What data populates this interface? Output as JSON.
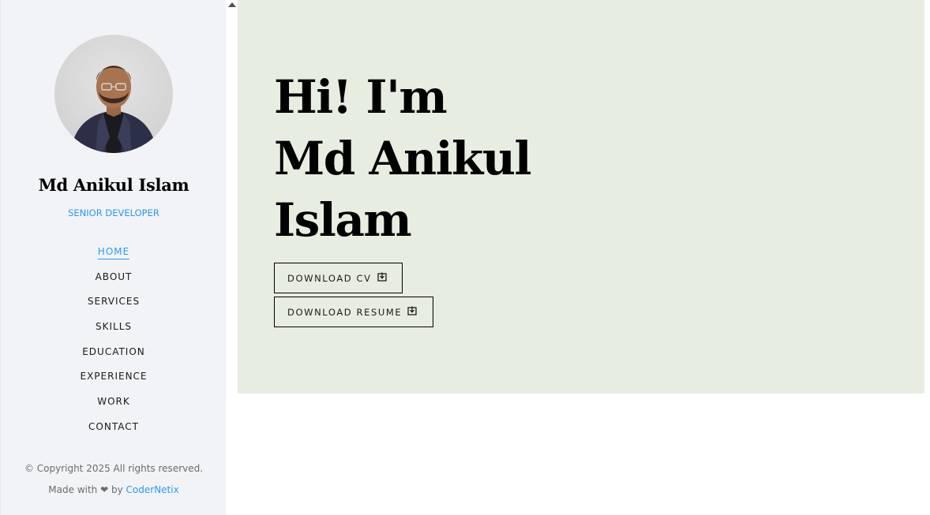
{
  "profile": {
    "name": "Md Anikul Islam",
    "role": "SENIOR DEVELOPER"
  },
  "nav": {
    "items": [
      {
        "label": "HOME",
        "active": true
      },
      {
        "label": "ABOUT",
        "active": false
      },
      {
        "label": "SERVICES",
        "active": false
      },
      {
        "label": "SKILLS",
        "active": false
      },
      {
        "label": "EDUCATION",
        "active": false
      },
      {
        "label": "EXPERIENCE",
        "active": false
      },
      {
        "label": "WORK",
        "active": false
      },
      {
        "label": "CONTACT",
        "active": false
      }
    ]
  },
  "footer": {
    "copyright": "© Copyright 2025 All rights reserved.",
    "made_with": "Made with",
    "heart": "❤",
    "by": "by",
    "credit_link": "CoderNetix"
  },
  "hero": {
    "line1": "Hi! I'm",
    "line2": "Md Anikul",
    "line3": "Islam",
    "download_cv_label": "DOWNLOAD CV",
    "download_resume_label": "DOWNLOAD RESUME"
  },
  "icons": {
    "avatar": "profile-photo",
    "download": "download-icon",
    "scroll_up": "chevron-up-icon"
  },
  "colors": {
    "accent": "#2c98f0",
    "sidebar_bg": "#f2f3f7",
    "hero_bg": "#e8ede1",
    "text": "#000000"
  }
}
